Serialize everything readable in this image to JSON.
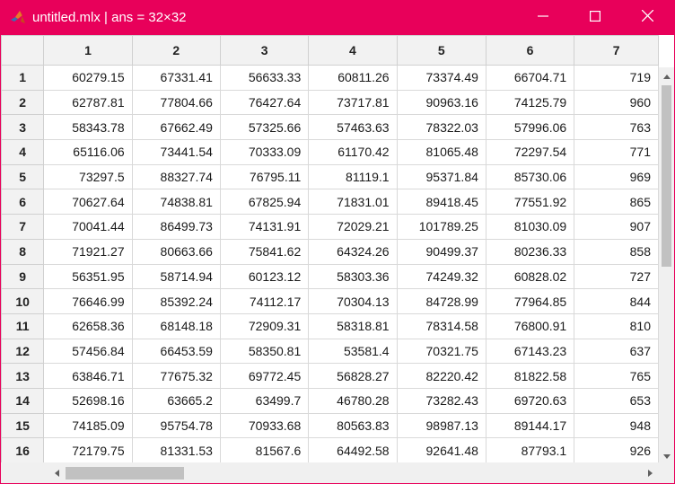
{
  "window": {
    "title": "untitled.mlx | ans = 32×32",
    "colors": {
      "titlebar": "#e8005a",
      "title_text": "#ffffff"
    }
  },
  "icons": {
    "app": "matlab-logo-icon",
    "minimize": "minimize-icon",
    "maximize": "maximize-icon",
    "close": "close-icon"
  },
  "table": {
    "column_headers": [
      "1",
      "2",
      "3",
      "4",
      "5",
      "6",
      "7"
    ],
    "rows": [
      {
        "index": "1",
        "values": [
          "60279.15",
          "67331.41",
          "56633.33",
          "60811.26",
          "73374.49",
          "66704.71",
          "719"
        ]
      },
      {
        "index": "2",
        "values": [
          "62787.81",
          "77804.66",
          "76427.64",
          "73717.81",
          "90963.16",
          "74125.79",
          "960"
        ]
      },
      {
        "index": "3",
        "values": [
          "58343.78",
          "67662.49",
          "57325.66",
          "57463.63",
          "78322.03",
          "57996.06",
          "763"
        ]
      },
      {
        "index": "4",
        "values": [
          "65116.06",
          "73441.54",
          "70333.09",
          "61170.42",
          "81065.48",
          "72297.54",
          "771"
        ]
      },
      {
        "index": "5",
        "values": [
          "73297.5",
          "88327.74",
          "76795.11",
          "81119.1",
          "95371.84",
          "85730.06",
          "969"
        ]
      },
      {
        "index": "6",
        "values": [
          "70627.64",
          "74838.81",
          "67825.94",
          "71831.01",
          "89418.45",
          "77551.92",
          "865"
        ]
      },
      {
        "index": "7",
        "values": [
          "70041.44",
          "86499.73",
          "74131.91",
          "72029.21",
          "101789.25",
          "81030.09",
          "907"
        ]
      },
      {
        "index": "8",
        "values": [
          "71921.27",
          "80663.66",
          "75841.62",
          "64324.26",
          "90499.37",
          "80236.33",
          "858"
        ]
      },
      {
        "index": "9",
        "values": [
          "56351.95",
          "58714.94",
          "60123.12",
          "58303.36",
          "74249.32",
          "60828.02",
          "727"
        ]
      },
      {
        "index": "10",
        "values": [
          "76646.99",
          "85392.24",
          "74112.17",
          "70304.13",
          "84728.99",
          "77964.85",
          "844"
        ]
      },
      {
        "index": "11",
        "values": [
          "62658.36",
          "68148.18",
          "72909.31",
          "58318.81",
          "78314.58",
          "76800.91",
          "810"
        ]
      },
      {
        "index": "12",
        "values": [
          "57456.84",
          "66453.59",
          "58350.81",
          "53581.4",
          "70321.75",
          "67143.23",
          "637"
        ]
      },
      {
        "index": "13",
        "values": [
          "63846.71",
          "77675.32",
          "69772.45",
          "56828.27",
          "82220.42",
          "81822.58",
          "765"
        ]
      },
      {
        "index": "14",
        "values": [
          "52698.16",
          "63665.2",
          "63499.7",
          "46780.28",
          "73282.43",
          "69720.63",
          "653"
        ]
      },
      {
        "index": "15",
        "values": [
          "74185.09",
          "95754.78",
          "70933.68",
          "80563.83",
          "98987.13",
          "89144.17",
          "948"
        ]
      },
      {
        "index": "16",
        "values": [
          "72179.75",
          "81331.53",
          "81567.6",
          "64492.58",
          "92641.48",
          "87793.1",
          "926"
        ]
      }
    ]
  }
}
